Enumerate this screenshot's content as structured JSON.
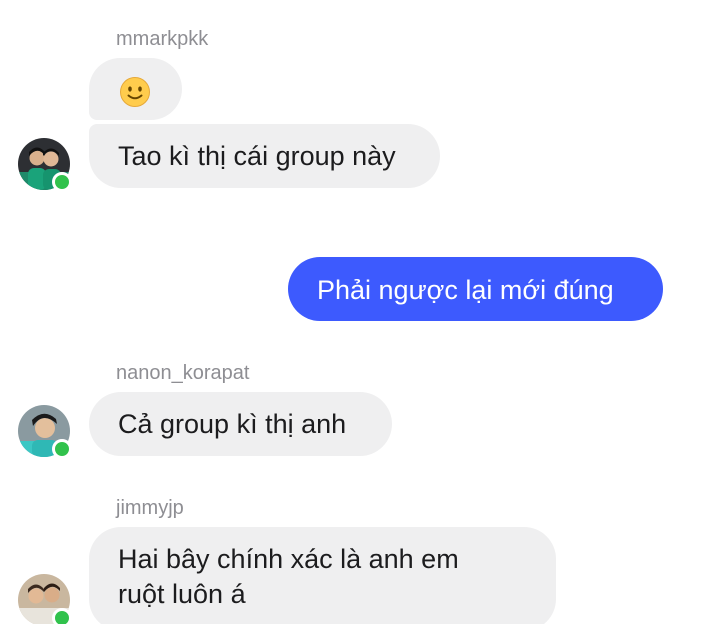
{
  "messages": [
    {
      "sender": "mmarkpkk",
      "emoji": "slightly-smiling-face",
      "text": "Tao kì thị cái group này"
    },
    {
      "outgoing": true,
      "text": "Phải ngược lại mới đúng"
    },
    {
      "sender": "nanon_korapat",
      "text": "Cả group kì thị anh"
    },
    {
      "sender": "jimmyjp",
      "line1": "Hai bây chính xác là anh em",
      "line2": "ruột luôn á"
    }
  ],
  "colors": {
    "outgoing_bubble": "#3d5afe",
    "incoming_bubble": "#efeff0",
    "online_dot": "#31c24c"
  }
}
